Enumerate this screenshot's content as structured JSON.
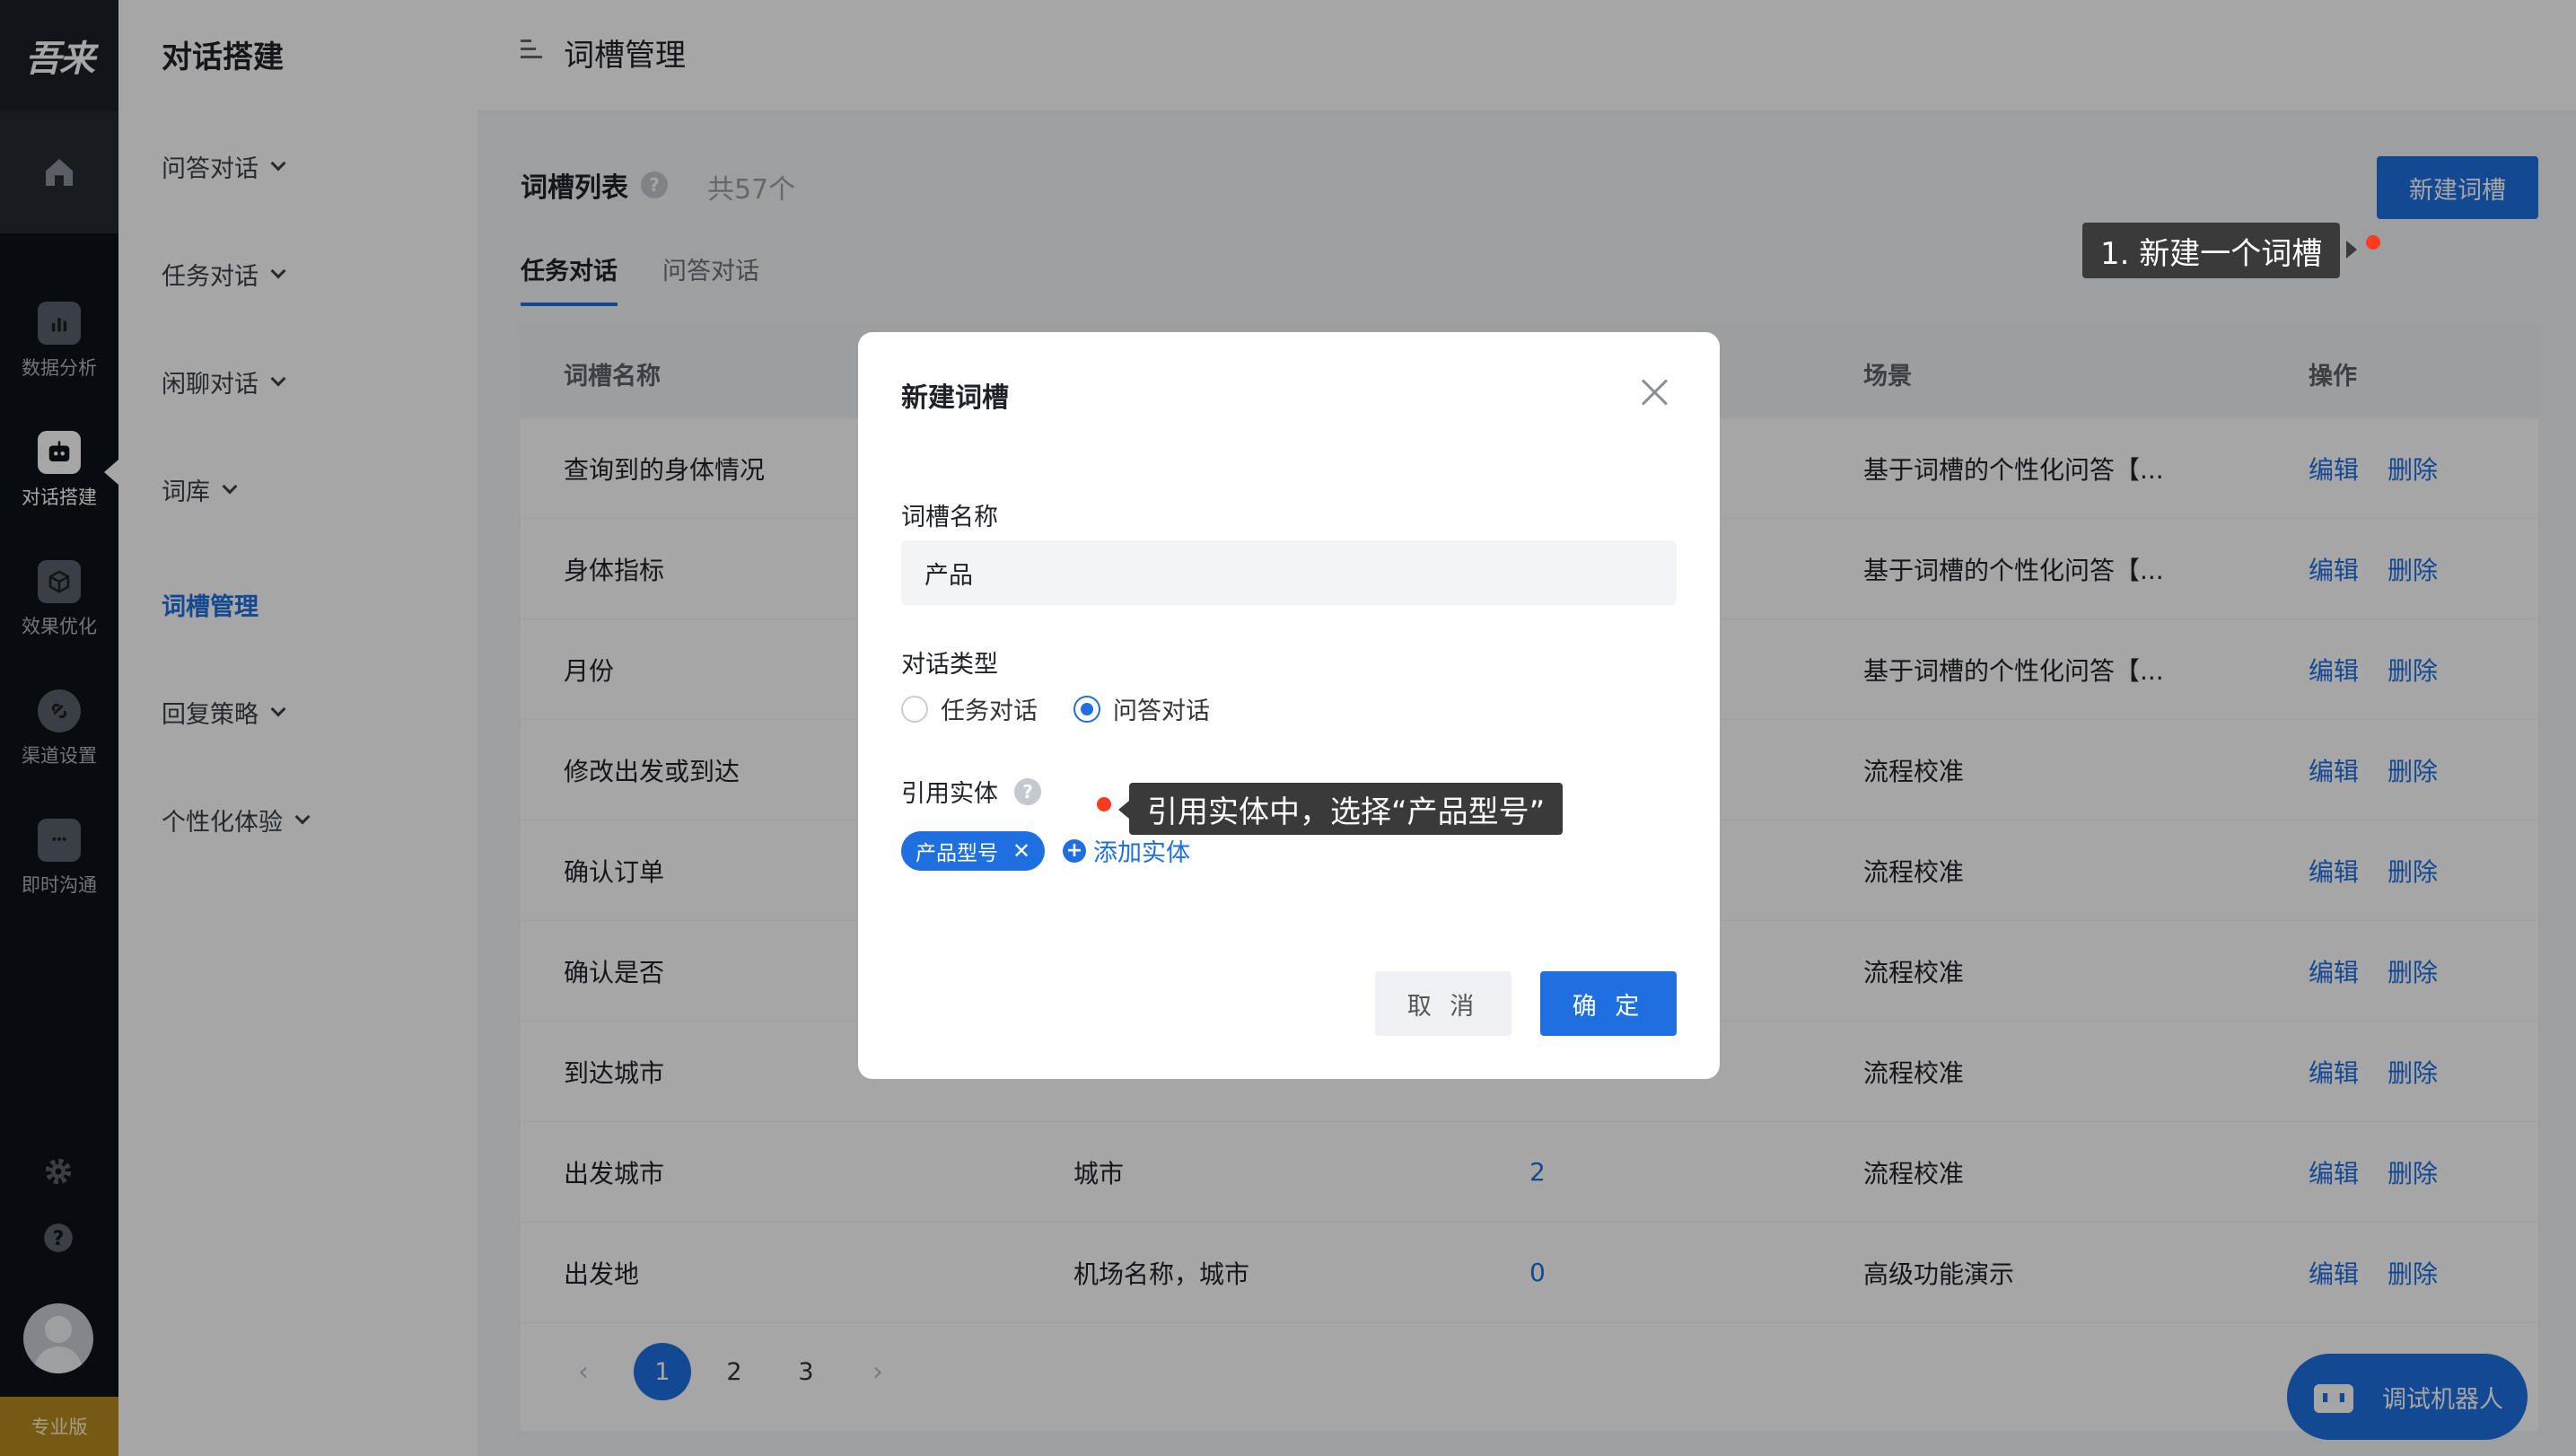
{
  "rail": {
    "logo": "吾来",
    "items": [
      {
        "label": "数据分析",
        "icon": "bar-chart-icon"
      },
      {
        "label": "对话搭建",
        "icon": "robot-icon"
      },
      {
        "label": "效果优化",
        "icon": "cube-icon"
      },
      {
        "label": "渠道设置",
        "icon": "link-icon"
      },
      {
        "label": "即时沟通",
        "icon": "chat-icon"
      }
    ],
    "edition": "专业版"
  },
  "sidebar": {
    "title": "对话搭建",
    "items": [
      {
        "label": "问答对话"
      },
      {
        "label": "任务对话"
      },
      {
        "label": "闲聊对话"
      },
      {
        "label": "词库"
      },
      {
        "label": "词槽管理"
      },
      {
        "label": "回复策略"
      },
      {
        "label": "个性化体验"
      }
    ]
  },
  "topbar": {
    "title": "词槽管理"
  },
  "main": {
    "list_title": "词槽列表",
    "count": "共57个",
    "new_button": "新建词槽",
    "tabs": [
      {
        "label": "任务对话"
      },
      {
        "label": "问答对话"
      }
    ],
    "headers": {
      "name": "词槽名称",
      "scene": "场景",
      "ops": "操作"
    },
    "rows": [
      {
        "name": "查询到的身体情况",
        "entity": "",
        "count": "",
        "scene": "基于词槽的个性化问答【..."
      },
      {
        "name": "身体指标",
        "entity": "",
        "count": "",
        "scene": "基于词槽的个性化问答【..."
      },
      {
        "name": "月份",
        "entity": "",
        "count": "",
        "scene": "基于词槽的个性化问答【..."
      },
      {
        "name": "修改出发或到达",
        "entity": "",
        "count": "",
        "scene": "流程校准"
      },
      {
        "name": "确认订单",
        "entity": "",
        "count": "",
        "scene": "流程校准"
      },
      {
        "name": "确认是否",
        "entity": "",
        "count": "",
        "scene": "流程校准"
      },
      {
        "name": "到达城市",
        "entity": "",
        "count": "",
        "scene": "流程校准"
      },
      {
        "name": "出发城市",
        "entity": "城市",
        "count": "2",
        "scene": "流程校准"
      },
      {
        "name": "出发地",
        "entity": "机场名称，城市",
        "count": "0",
        "scene": "高级功能演示"
      }
    ],
    "edit_label": "编辑",
    "delete_label": "删除",
    "pages": [
      "1",
      "2",
      "3"
    ]
  },
  "modal": {
    "title": "新建词槽",
    "name_label": "词槽名称",
    "name_value": "产品",
    "type_label": "对话类型",
    "type_options": [
      "任务对话",
      "问答对话"
    ],
    "type_selected": "问答对话",
    "entity_label": "引用实体",
    "entity_chip": "产品型号",
    "add_entity": "添加实体",
    "cancel": "取 消",
    "ok": "确 定"
  },
  "tooltips": {
    "step1": "1. 新建一个词槽",
    "step2": "引用实体中，选择“产品型号”"
  },
  "robot": {
    "label": "调试机器人"
  },
  "colors": {
    "accent": "#1e6fe0",
    "marker": "#ff3b1f"
  }
}
